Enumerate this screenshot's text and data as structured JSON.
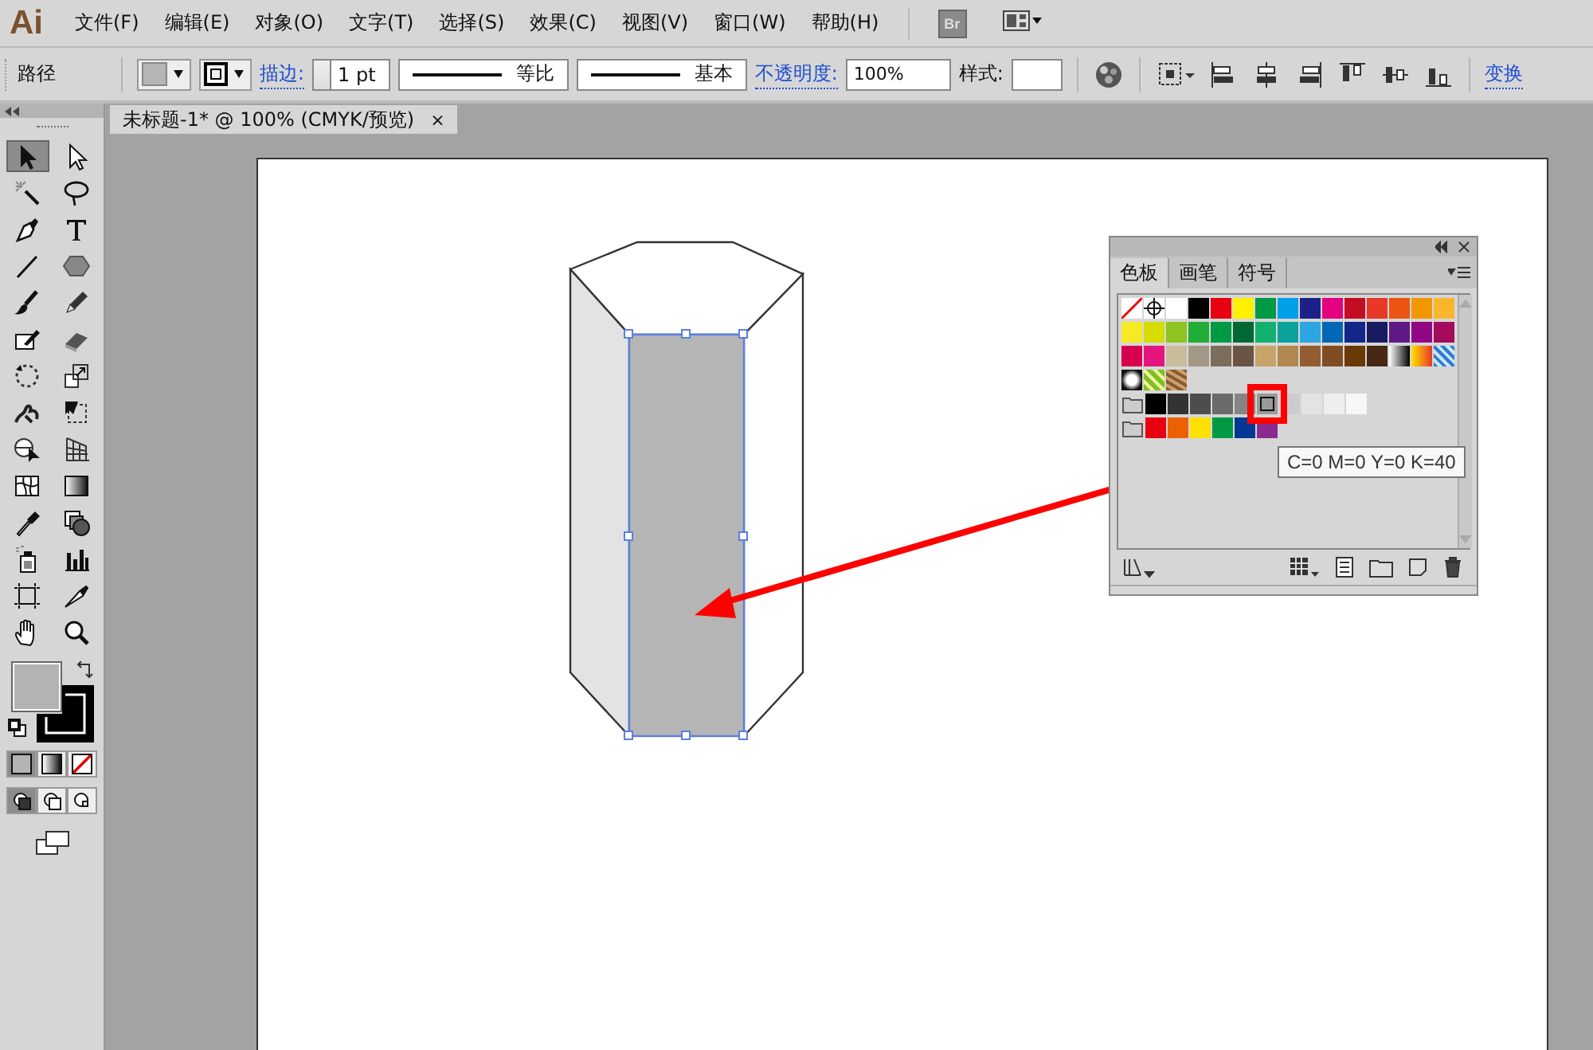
{
  "app": {
    "logo": "Ai",
    "bridge": "Br"
  },
  "menu": [
    "文件(F)",
    "编辑(E)",
    "对象(O)",
    "文字(T)",
    "选择(S)",
    "效果(C)",
    "视图(V)",
    "窗口(W)",
    "帮助(H)"
  ],
  "control_bar": {
    "object_type": "路径",
    "stroke_label": "描边:",
    "stroke_weight": "1 pt",
    "profile": "等比",
    "brush": "基本",
    "opacity_label": "不透明度:",
    "opacity": "100%",
    "style_label": "样式:",
    "transform": "变换"
  },
  "document_tab": {
    "title": "未标题-1* @ 100% (CMYK/预览)",
    "close": "×"
  },
  "tools": [
    {
      "kind": "selection",
      "selected": true
    },
    {
      "kind": "direct",
      "selected": false
    },
    {
      "kind": "wand",
      "selected": false
    },
    {
      "kind": "lasso",
      "selected": false
    },
    {
      "kind": "pen",
      "selected": false
    },
    {
      "kind": "type",
      "selected": false
    },
    {
      "kind": "line",
      "selected": false
    },
    {
      "kind": "polygon",
      "selected": false
    },
    {
      "kind": "brush",
      "selected": false
    },
    {
      "kind": "pencil",
      "selected": false
    },
    {
      "kind": "blob",
      "selected": false
    },
    {
      "kind": "eraser",
      "selected": false
    },
    {
      "kind": "rotate",
      "selected": false
    },
    {
      "kind": "scale",
      "selected": false
    },
    {
      "kind": "warp",
      "selected": false
    },
    {
      "kind": "freetransform",
      "selected": false
    },
    {
      "kind": "shapebuilder",
      "selected": false
    },
    {
      "kind": "perspective",
      "selected": false
    },
    {
      "kind": "mesh",
      "selected": false
    },
    {
      "kind": "gradient",
      "selected": false
    },
    {
      "kind": "eyedropper",
      "selected": false
    },
    {
      "kind": "blend",
      "selected": false
    },
    {
      "kind": "sprayer",
      "selected": false
    },
    {
      "kind": "graph",
      "selected": false
    },
    {
      "kind": "artboard",
      "selected": false
    },
    {
      "kind": "slice",
      "selected": false
    },
    {
      "kind": "hand",
      "selected": false
    },
    {
      "kind": "zoom",
      "selected": false
    }
  ],
  "fill_modes": [
    {
      "kind": "color",
      "selected": true
    },
    {
      "kind": "gradient",
      "selected": false
    },
    {
      "kind": "none",
      "selected": false
    }
  ],
  "draw_modes": [
    {
      "kind": "normal",
      "selected": true
    },
    {
      "kind": "behind",
      "selected": false
    },
    {
      "kind": "inside",
      "selected": false
    }
  ],
  "swatches_panel": {
    "tabs": [
      {
        "label": "色板",
        "selected": true
      },
      {
        "label": "画笔",
        "selected": false
      },
      {
        "label": "符号",
        "selected": false
      }
    ],
    "rows": [
      {
        "group": false,
        "swatches": [
          {
            "kind": "none",
            "selected": false
          },
          {
            "kind": "registration",
            "selected": false
          },
          {
            "kind": "color",
            "color": "#ffffff",
            "selected": false
          },
          {
            "kind": "color",
            "color": "#000000",
            "selected": false
          },
          {
            "kind": "color",
            "color": "#e60012",
            "selected": false
          },
          {
            "kind": "color",
            "color": "#fff100",
            "selected": false
          },
          {
            "kind": "color",
            "color": "#009944",
            "selected": false
          },
          {
            "kind": "color",
            "color": "#00a0e9",
            "selected": false
          },
          {
            "kind": "color",
            "color": "#1d2088",
            "selected": false
          },
          {
            "kind": "color",
            "color": "#e4007f",
            "selected": false
          },
          {
            "kind": "color",
            "color": "#c30d23",
            "selected": false
          },
          {
            "kind": "color",
            "color": "#e83828",
            "selected": false
          },
          {
            "kind": "color",
            "color": "#ea5514",
            "selected": false
          },
          {
            "kind": "color",
            "color": "#f39800",
            "selected": false
          },
          {
            "kind": "color",
            "color": "#f8b62d",
            "selected": false
          }
        ]
      },
      {
        "group": false,
        "swatches": [
          {
            "kind": "color",
            "color": "#f6ea24",
            "selected": false
          },
          {
            "kind": "color",
            "color": "#d4dc00",
            "selected": false
          },
          {
            "kind": "color",
            "color": "#8fc31f",
            "selected": false
          },
          {
            "kind": "color",
            "color": "#22ac38",
            "selected": false
          },
          {
            "kind": "color",
            "color": "#009944",
            "selected": false
          },
          {
            "kind": "color",
            "color": "#006934",
            "selected": false
          },
          {
            "kind": "color",
            "color": "#13b16f",
            "selected": false
          },
          {
            "kind": "color",
            "color": "#0aa29b",
            "selected": false
          },
          {
            "kind": "color",
            "color": "#2ca6e0",
            "selected": false
          },
          {
            "kind": "color",
            "color": "#0068b7",
            "selected": false
          },
          {
            "kind": "color",
            "color": "#13268a",
            "selected": false
          },
          {
            "kind": "color",
            "color": "#171c61",
            "selected": false
          },
          {
            "kind": "color",
            "color": "#601986",
            "selected": false
          },
          {
            "kind": "color",
            "color": "#920783",
            "selected": false
          },
          {
            "kind": "color",
            "color": "#a40b5d",
            "selected": false
          }
        ]
      },
      {
        "group": false,
        "swatches": [
          {
            "kind": "color",
            "color": "#d7004f",
            "selected": false
          },
          {
            "kind": "color",
            "color": "#e4157f",
            "selected": false
          },
          {
            "kind": "color",
            "color": "#c9bc9c",
            "selected": false
          },
          {
            "kind": "color",
            "color": "#a39887",
            "selected": false
          },
          {
            "kind": "color",
            "color": "#7d6e5b",
            "selected": false
          },
          {
            "kind": "color",
            "color": "#6a5443",
            "selected": false
          },
          {
            "kind": "color",
            "color": "#c7a36a",
            "selected": false
          },
          {
            "kind": "color",
            "color": "#b28850",
            "selected": false
          },
          {
            "kind": "color",
            "color": "#935d31",
            "selected": false
          },
          {
            "kind": "color",
            "color": "#7e4d22",
            "selected": false
          },
          {
            "kind": "color",
            "color": "#6a3906",
            "selected": false
          },
          {
            "kind": "color",
            "color": "#462815",
            "selected": false
          },
          {
            "kind": "gradient-bw",
            "selected": false
          },
          {
            "kind": "gradient-warm",
            "selected": false
          },
          {
            "kind": "pattern-blue",
            "selected": false
          }
        ]
      },
      {
        "group": false,
        "swatches": [
          {
            "kind": "pattern-dots",
            "selected": false
          },
          {
            "kind": "pattern-leaf",
            "selected": false
          },
          {
            "kind": "pattern-stone",
            "selected": false
          }
        ]
      },
      {
        "group": true,
        "swatches": [
          {
            "kind": "color",
            "color": "#000000",
            "selected": false
          },
          {
            "kind": "color",
            "color": "#333333",
            "selected": false
          },
          {
            "kind": "color",
            "color": "#4d4d4d",
            "selected": false
          },
          {
            "kind": "color",
            "color": "#6b6b6b",
            "selected": false
          },
          {
            "kind": "color",
            "color": "#858585",
            "selected": false
          },
          {
            "kind": "color",
            "color": "#999999",
            "selected": true
          },
          {
            "kind": "color",
            "color": "#cccccc",
            "selected": false
          },
          {
            "kind": "color",
            "color": "#e3e3e3",
            "selected": false
          },
          {
            "kind": "color",
            "color": "#eeeeee",
            "selected": false
          },
          {
            "kind": "color",
            "color": "#f7f7f7",
            "selected": false
          }
        ]
      },
      {
        "group": true,
        "swatches": [
          {
            "kind": "color",
            "color": "#e60012",
            "selected": false
          },
          {
            "kind": "color",
            "color": "#eb6100",
            "selected": false
          },
          {
            "kind": "color",
            "color": "#ffe100",
            "selected": false
          },
          {
            "kind": "color",
            "color": "#009944",
            "selected": false
          },
          {
            "kind": "color",
            "color": "#003894",
            "selected": false
          },
          {
            "kind": "color",
            "color": "#8a2c8f",
            "selected": false
          }
        ]
      }
    ],
    "tooltip": "C=0 M=0 Y=0 K=40"
  }
}
